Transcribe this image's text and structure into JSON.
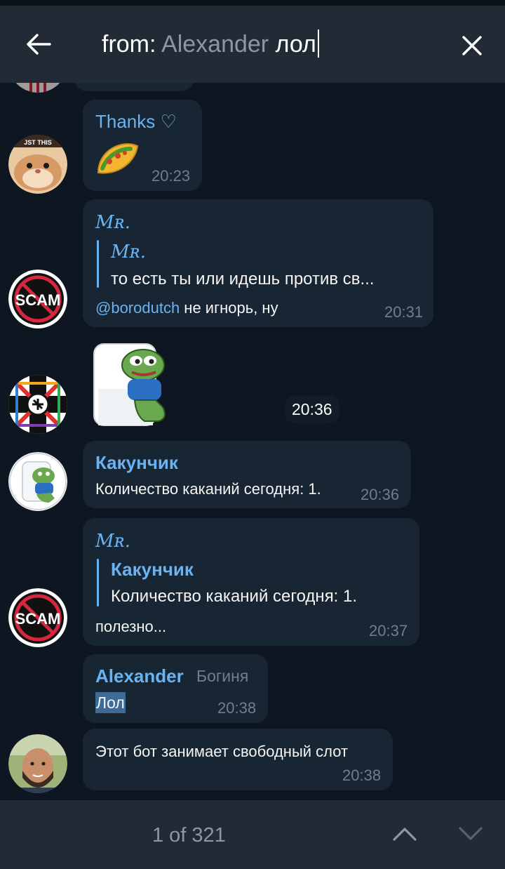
{
  "search": {
    "prefix": "from:",
    "user": "Alexander",
    "query": "лол"
  },
  "messages": [
    {
      "sender": "Thanks ♡",
      "time": "20:23",
      "sticker": "taco"
    },
    {
      "sender": "Mʀ.",
      "quote_sender": "Mʀ.",
      "quote_text": "то есть ты или идешь против св...",
      "mention": "@borodutch",
      "text": " не игнорь, ну",
      "time": "20:31"
    },
    {
      "time": "20:36",
      "sticker": "pepe-toilet"
    },
    {
      "sender": "Какунчик",
      "text": "Количество каканий сегодня: 1.",
      "time": "20:36"
    },
    {
      "sender": "Mʀ.",
      "quote_sender": "Какунчик",
      "quote_text": "Количество каканий сегодня: 1.",
      "text": "полезно...",
      "time": "20:37"
    },
    {
      "sender": "Alexander",
      "rank": "Богиня",
      "text": "Лол",
      "time": "20:38"
    },
    {
      "text": "Этот бот занимает свободный слот",
      "time": "20:38"
    }
  ],
  "avatars": {
    "scam_label": "SCAM"
  },
  "footer": {
    "counter": "1 of 321"
  },
  "colors": {
    "background": "#0e1621",
    "bar": "#222b35",
    "bubble": "#182533",
    "accent": "#6ab3f3"
  }
}
